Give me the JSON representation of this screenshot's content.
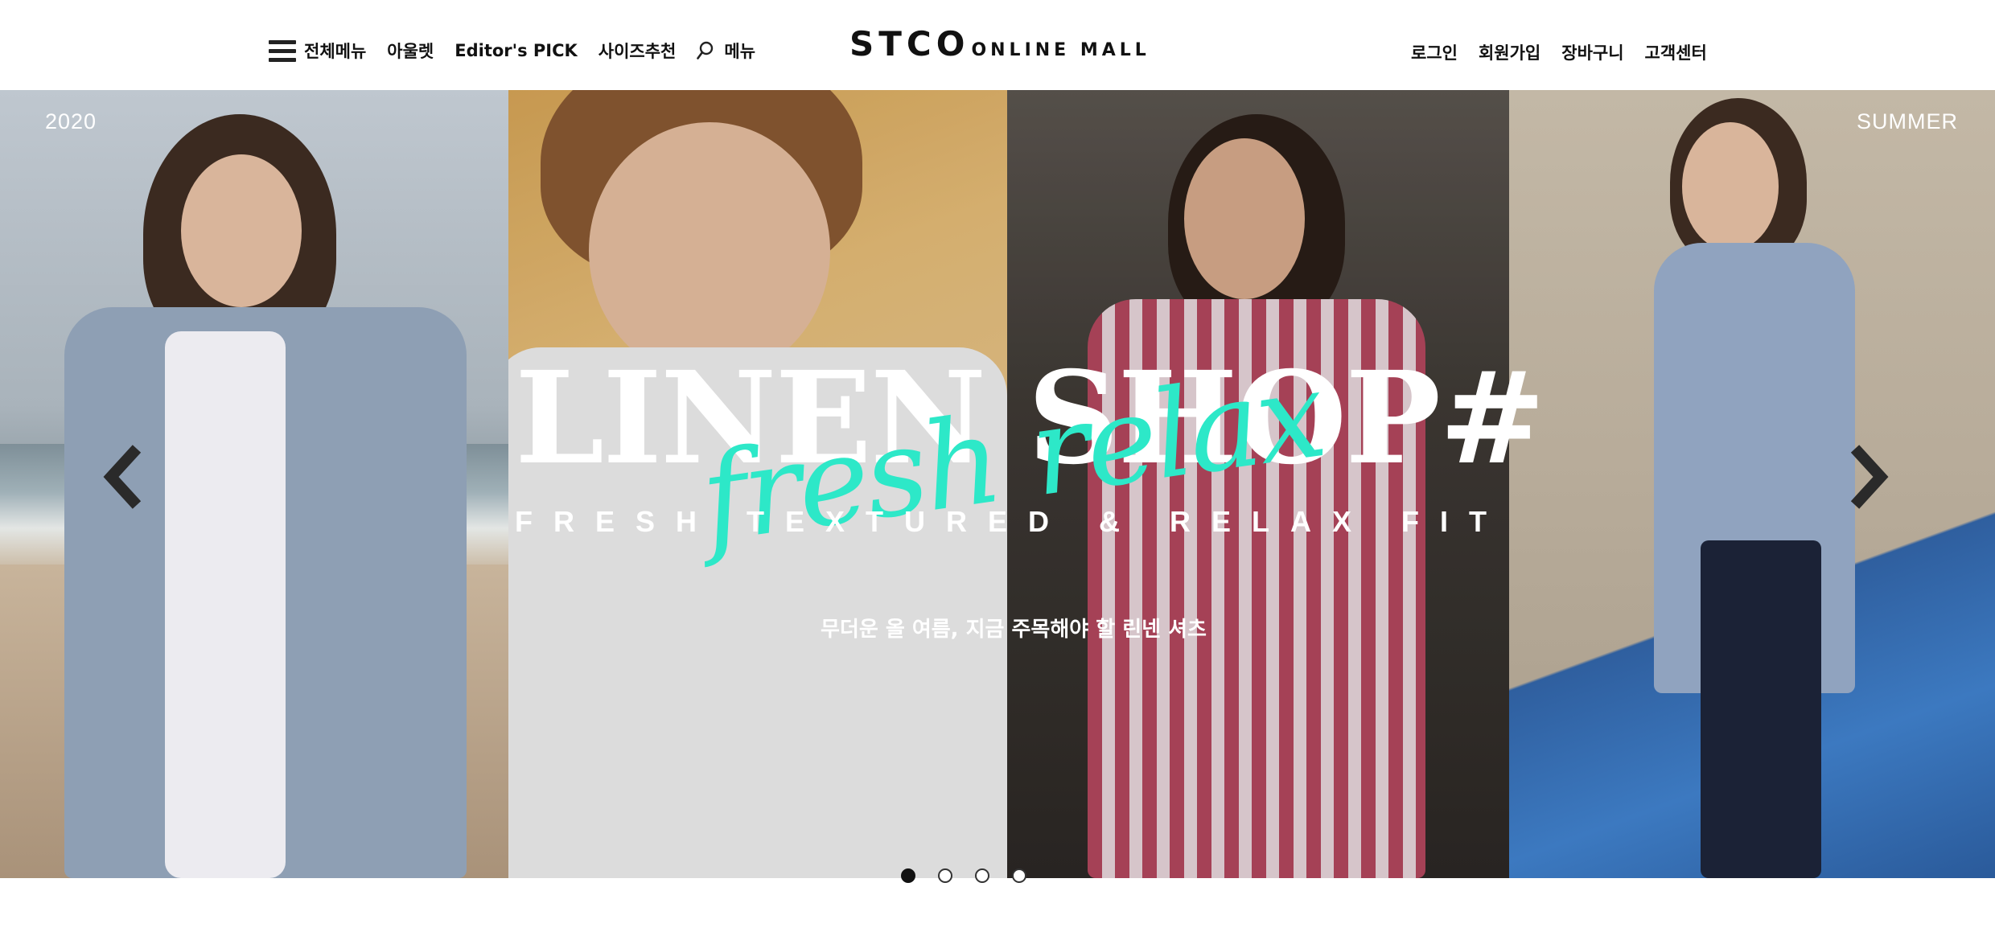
{
  "header": {
    "all_menu_label": "전체메뉴",
    "nav_items": [
      "아울렛",
      "Editor's PICK",
      "사이즈추천"
    ],
    "search_menu_label": "메뉴",
    "logo_main": "STCO",
    "logo_sub": "ONLINE MALL",
    "account_links": [
      "로그인",
      "회원가입",
      "장바구니",
      "고객센터"
    ]
  },
  "hero": {
    "corner_left": "2020",
    "corner_right": "SUMMER",
    "headline": "LINEN SHOP#",
    "script_text": "fresh relax",
    "subline": "FRESH TEXTURED & RELAX FIT",
    "caption": "무더운 올 여름, 지금 주목해야 할 린넨 셔츠",
    "accent_color": "#2de8c8"
  },
  "slider": {
    "slide_count": 4,
    "active_index": 0
  },
  "icons": {
    "menu": "hamburger-icon",
    "search": "search-icon",
    "prev": "chevron-left-icon",
    "next": "chevron-right-icon"
  }
}
